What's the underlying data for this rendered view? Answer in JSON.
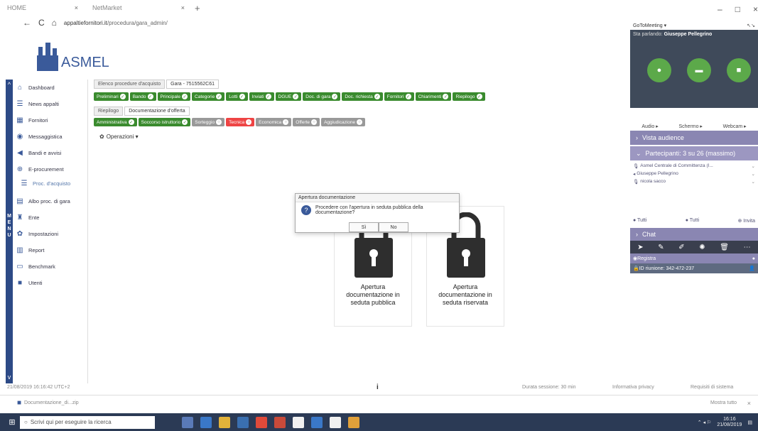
{
  "browser": {
    "tabs": [
      {
        "label": "HOME",
        "close": "×"
      },
      {
        "label": "NetMarket",
        "close": "×"
      }
    ],
    "new_tab": "+",
    "url_host": "appaltiefornitori.it",
    "url_path": "/procedura/gara_admin/"
  },
  "window_controls": [
    "–",
    "□",
    "×"
  ],
  "logo": {
    "text": "ASMEL"
  },
  "sidebar": {
    "scroll_up": "^",
    "menu_label": [
      "M",
      "E",
      "N",
      "U"
    ],
    "scroll_down": "v",
    "items": [
      {
        "label": "Dashboard",
        "icon": "home-icon",
        "glyph": "⌂"
      },
      {
        "label": "News appalti",
        "icon": "news-icon",
        "glyph": "☰"
      },
      {
        "label": "Fornitori",
        "icon": "suppliers-icon",
        "glyph": "▦"
      },
      {
        "label": "Messaggistica",
        "icon": "message-icon",
        "glyph": "◉"
      },
      {
        "label": "Bandi e avvisi",
        "icon": "megaphone-icon",
        "glyph": "◀"
      },
      {
        "label": "E-procurement",
        "icon": "procurement-icon",
        "glyph": "⊕"
      }
    ],
    "sub_item": {
      "label": "Proc. d'acquisto",
      "glyph": "☰"
    },
    "items2": [
      {
        "label": "Albo proc. di gara",
        "icon": "register-icon",
        "glyph": "▤"
      },
      {
        "label": "Ente",
        "icon": "building-icon",
        "glyph": "♜"
      },
      {
        "label": "Impostazioni",
        "icon": "settings-icon",
        "glyph": "✿"
      },
      {
        "label": "Report",
        "icon": "report-icon",
        "glyph": "▥"
      },
      {
        "label": "Benchmark",
        "icon": "benchmark-icon",
        "glyph": "▭"
      },
      {
        "label": "Utenti",
        "icon": "users-icon",
        "glyph": "■"
      }
    ]
  },
  "breadcrumbs": [
    "Elenco procedure d'acquisto",
    "Gara - 7515562C61"
  ],
  "tabs_row1": [
    "Preliminari",
    "Bando",
    "Principale",
    "Categorie",
    "Lotti",
    "Inviati",
    "DGUE",
    "Doc. di gara",
    "Doc. richiesta",
    "Fornitori",
    "Chiarimenti",
    "Riepilogo"
  ],
  "subtabs": [
    "Riepilogo",
    "Documentazione d'offerta"
  ],
  "tabs_row3": [
    {
      "label": "Amministrativa",
      "state": "ok"
    },
    {
      "label": "Soccorso istruttorio",
      "state": "ok"
    },
    {
      "label": "Sorteggio",
      "state": "gray"
    },
    {
      "label": "Tecnica",
      "state": "red"
    },
    {
      "label": "Economica",
      "state": "gray"
    },
    {
      "label": "Offerte",
      "state": "gray"
    },
    {
      "label": "Aggiudicazione",
      "state": "gray"
    }
  ],
  "operations": "Operazioni ▾",
  "dialog": {
    "title": "Apertura documentazione",
    "question": "Procedere con l'apertura in seduta pubblica della documentazione?",
    "yes": "Sì",
    "no": "No"
  },
  "cards": [
    {
      "line1": "Apertura",
      "line2": "documentazione in",
      "line3": "seduta pubblica"
    },
    {
      "line1": "Apertura",
      "line2": "documentazione in",
      "line3": "seduta riservata"
    }
  ],
  "status": {
    "date": "21/08/2019 16:16:42 UTC+2",
    "info": "i",
    "durata": "Durata sessione: 30 min",
    "privacy": "Informativa privacy",
    "requisiti": "Requisiti di sistema"
  },
  "downloads": {
    "file": "Documentazione_di...zip",
    "show_all": "Mostra tutto",
    "close": "×"
  },
  "taskbar": {
    "search": "Scrivi qui per eseguire la ricerca",
    "time": "16:16",
    "date": "21/08/2019"
  },
  "gtm": {
    "app": "GoToMeeting ▾",
    "speaking_label": "Sta parlando:",
    "speaker": "Giuseppe Pellegrino",
    "audio": "Audio ▸",
    "screen": "Schermo ▸",
    "webcam": "Webcam ▸",
    "audience": "Vista audience",
    "participants": "Partecipanti: 3 su 26 (massimo)",
    "people": [
      "Asmel Centrale di Committenza (I...",
      "Giuseppe Pellegrino",
      "nicola sacco"
    ],
    "all1": "Tutti",
    "all2": "Tutti",
    "invite": "Invita",
    "chat": "Chat",
    "register": "Registra",
    "session_id": "ID riunione: 342-472-237"
  }
}
